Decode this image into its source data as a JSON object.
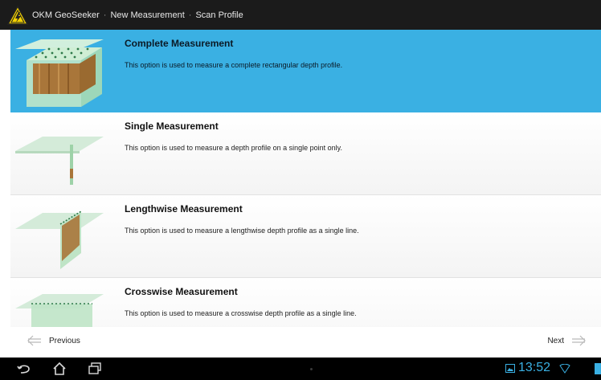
{
  "titlebar": {
    "app_name": "OKM GeoSeeker",
    "crumb_1": "New Measurement",
    "crumb_2": "Scan Profile",
    "separator": "·",
    "logo_icon": "warning-triangle-icon"
  },
  "options": [
    {
      "title": "Complete Measurement",
      "description": "This option is used to measure a complete rectangular depth profile.",
      "selected": true,
      "icon": "complete-profile-icon"
    },
    {
      "title": "Single Measurement",
      "description": "This option is used to measure a depth profile on a single point only.",
      "selected": false,
      "icon": "single-point-profile-icon"
    },
    {
      "title": "Lengthwise Measurement",
      "description": "This option is used to measure a lengthwise depth profile as a single line.",
      "selected": false,
      "icon": "lengthwise-profile-icon"
    },
    {
      "title": "Crosswise Measurement",
      "description": "This option is used to measure a crosswise depth profile as a single line.",
      "selected": false,
      "icon": "crosswise-profile-icon"
    }
  ],
  "navigation": {
    "previous_label": "Previous",
    "next_label": "Next"
  },
  "status": {
    "time": "13:52"
  },
  "colors": {
    "accent": "#3ab0e3",
    "titlebar_bg": "#1b1b1b",
    "logo_yellow": "#f3d100"
  }
}
